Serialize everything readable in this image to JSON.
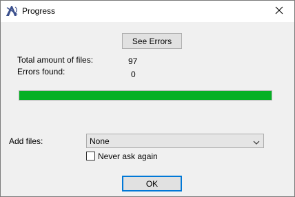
{
  "window": {
    "title": "Progress",
    "app_icon": "app-logo-icon",
    "close_icon": "close-icon"
  },
  "see_errors_label": "See Errors",
  "stats": {
    "total_label": "Total amount of files:",
    "total_value": "97",
    "errors_label": "Errors found:",
    "errors_value": "0"
  },
  "progress": {
    "fraction": 1.0,
    "color": "#06b025"
  },
  "add_files": {
    "label": "Add files:",
    "selected": "None",
    "chevron_icon": "chevron-down-icon"
  },
  "never_ask": {
    "label": "Never ask again",
    "checked": false
  },
  "ok_label": "OK",
  "colors": {
    "accent": "#0078d7",
    "progress": "#06b025"
  }
}
